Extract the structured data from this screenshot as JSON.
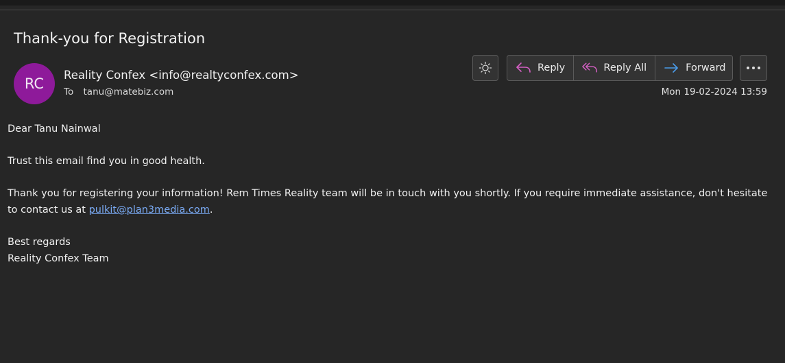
{
  "email": {
    "subject": "Thank-you for Registration",
    "avatar_initials": "RC",
    "avatar_color": "#8e1a9a",
    "sender": "Reality Confex <info@realtyconfex.com>",
    "to_label": "To",
    "to_address": "tanu@matebiz.com",
    "date": "Mon 19-02-2024 13:59"
  },
  "toolbar": {
    "theme_icon": "sun-icon",
    "reply_label": "Reply",
    "reply_all_label": "Reply All",
    "forward_label": "Forward",
    "more_icon": "more-icon"
  },
  "body": {
    "greeting": "Dear Tanu Nainwal",
    "line1": "Trust this email find you in good health.",
    "line2_before": "Thank you for registering your information! Rem Times Reality team will be in touch with you shortly. If you require immediate assistance, don't hesitate to contact us at ",
    "link": "pulkit@plan3media.com",
    "line2_after": ".",
    "closing": "Best regards",
    "signature": "Reality Confex Team"
  },
  "colors": {
    "background": "#262626",
    "link": "#79a9f2",
    "reply_icon": "#d55fc4",
    "forward_icon": "#4a9be8"
  }
}
